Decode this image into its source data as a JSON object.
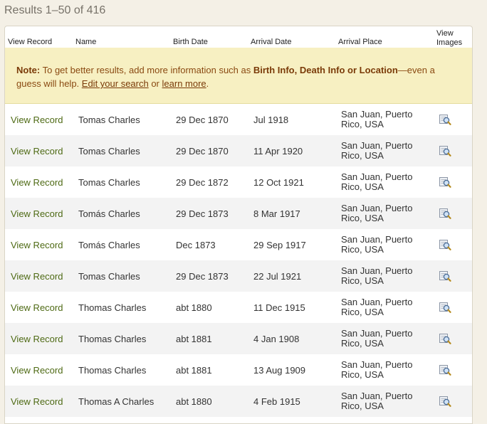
{
  "header": {
    "results_text": "Results 1–50 of 416"
  },
  "columns": {
    "view_record": "View Record",
    "name": "Name",
    "birth_date": "Birth Date",
    "arrival_date": "Arrival Date",
    "arrival_place": "Arrival Place",
    "view_images_line1": "View",
    "view_images_line2": "Images"
  },
  "note": {
    "label": "Note:",
    "text1": " To get better results, add more information such as ",
    "bold": "Birth Info, Death Info or Location",
    "text2": "—even a guess will help. ",
    "link1": "Edit your search",
    "text3": " or ",
    "link2": "learn more",
    "text4": "."
  },
  "rows": [
    {
      "view": "View Record",
      "name": "Tomas Charles",
      "birth": "29 Dec 1870",
      "arrival": "Jul 1918",
      "place": "San Juan, Puerto Rico, USA"
    },
    {
      "view": "View Record",
      "name": "Tomas Charles",
      "birth": "29 Dec 1870",
      "arrival": "11 Apr 1920",
      "place": "San Juan, Puerto Rico, USA"
    },
    {
      "view": "View Record",
      "name": "Tomas Charles",
      "birth": "29 Dec 1872",
      "arrival": "12 Oct 1921",
      "place": "San Juan, Puerto Rico, USA"
    },
    {
      "view": "View Record",
      "name": "Tomás Charles",
      "birth": "29 Dec 1873",
      "arrival": "8 Mar 1917",
      "place": "San Juan, Puerto Rico, USA"
    },
    {
      "view": "View Record",
      "name": "Tomás Charles",
      "birth": "Dec 1873",
      "arrival": "29 Sep 1917",
      "place": "San Juan, Puerto Rico, USA"
    },
    {
      "view": "View Record",
      "name": "Tomas Charles",
      "birth": "29 Dec 1873",
      "arrival": "22 Jul 1921",
      "place": "San Juan, Puerto Rico, USA"
    },
    {
      "view": "View Record",
      "name": "Thomas Charles",
      "birth": "abt 1880",
      "arrival": "11 Dec 1915",
      "place": "San Juan, Puerto Rico, USA"
    },
    {
      "view": "View Record",
      "name": "Thomas Charles",
      "birth": "abt 1881",
      "arrival": "4 Jan 1908",
      "place": "San Juan, Puerto Rico, USA"
    },
    {
      "view": "View Record",
      "name": "Thomas Charles",
      "birth": "abt 1881",
      "arrival": "13 Aug 1909",
      "place": "San Juan, Puerto Rico, USA"
    },
    {
      "view": "View Record",
      "name": "Thomas A Charles",
      "birth": "abt 1880",
      "arrival": "4 Feb 1915",
      "place": "San Juan, Puerto Rico, USA"
    }
  ],
  "icons": {
    "view_image": "view-image-icon"
  },
  "colors": {
    "link_green": "#4e6a14",
    "note_bg": "#f7f0c2",
    "note_text": "#8a4a12",
    "page_bg": "#f4f0e6"
  }
}
